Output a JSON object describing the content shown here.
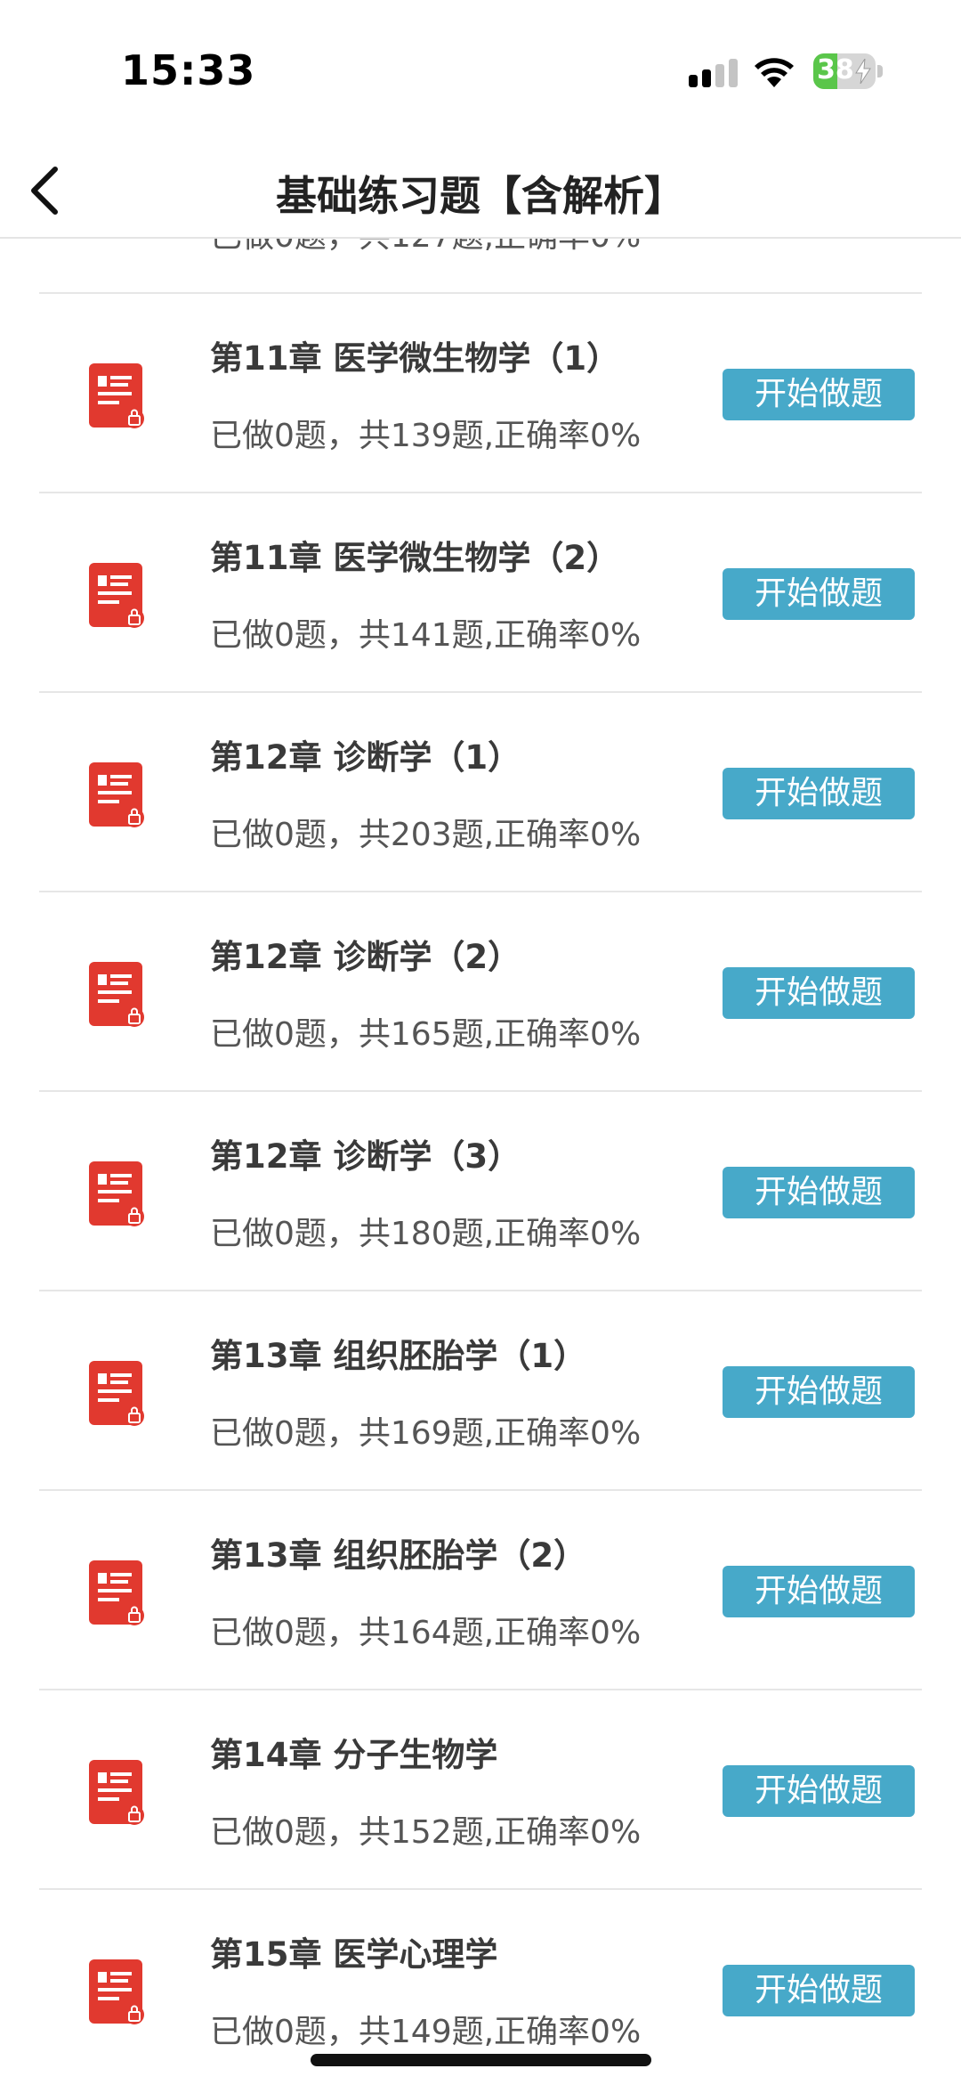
{
  "status_bar": {
    "time": "15:33",
    "battery_percent": "38",
    "battery_level": 0.38,
    "icons": [
      "signal-icon",
      "wifi-icon",
      "battery-icon"
    ]
  },
  "nav": {
    "title": "基础练习题【含解析】",
    "back_icon": "chevron-left-icon"
  },
  "colors": {
    "accent_button": "#47a9c9",
    "icon_red": "#e1392f",
    "divider": "#e6e6e6",
    "battery_green": "#5ac64a"
  },
  "partial_item": {
    "stats": "已做0题，共127题,正确率0%"
  },
  "items": [
    {
      "title": "第11章 医学微生物学（1）",
      "stats": "已做0题，共139题,正确率0%",
      "button": "开始做题"
    },
    {
      "title": "第11章 医学微生物学（2）",
      "stats": "已做0题，共141题,正确率0%",
      "button": "开始做题"
    },
    {
      "title": "第12章 诊断学（1）",
      "stats": "已做0题，共203题,正确率0%",
      "button": "开始做题"
    },
    {
      "title": "第12章 诊断学（2）",
      "stats": "已做0题，共165题,正确率0%",
      "button": "开始做题"
    },
    {
      "title": "第12章 诊断学（3）",
      "stats": "已做0题，共180题,正确率0%",
      "button": "开始做题"
    },
    {
      "title": "第13章 组织胚胎学（1）",
      "stats": "已做0题，共169题,正确率0%",
      "button": "开始做题"
    },
    {
      "title": "第13章 组织胚胎学（2）",
      "stats": "已做0题，共164题,正确率0%",
      "button": "开始做题"
    },
    {
      "title": "第14章 分子生物学",
      "stats": "已做0题，共152题,正确率0%",
      "button": "开始做题"
    },
    {
      "title": "第15章 医学心理学",
      "stats": "已做0题，共149题,正确率0%",
      "button": "开始做题"
    }
  ]
}
